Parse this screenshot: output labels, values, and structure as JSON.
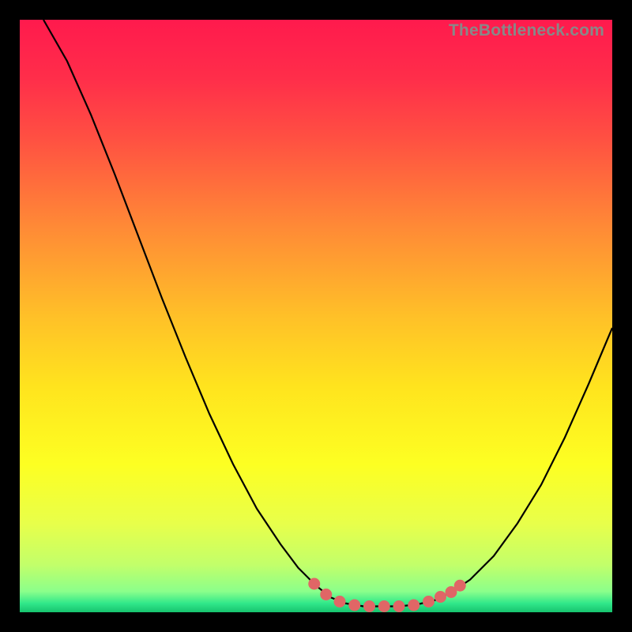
{
  "watermark": "TheBottleneck.com",
  "gradient": {
    "stops": [
      {
        "offset": 0.0,
        "color": "#ff1a4d"
      },
      {
        "offset": 0.1,
        "color": "#ff2e4a"
      },
      {
        "offset": 0.2,
        "color": "#ff5042"
      },
      {
        "offset": 0.35,
        "color": "#ff8a36"
      },
      {
        "offset": 0.5,
        "color": "#ffc028"
      },
      {
        "offset": 0.62,
        "color": "#ffe41e"
      },
      {
        "offset": 0.75,
        "color": "#fdff22"
      },
      {
        "offset": 0.85,
        "color": "#e8ff4a"
      },
      {
        "offset": 0.92,
        "color": "#c2ff6a"
      },
      {
        "offset": 0.965,
        "color": "#8bff8b"
      },
      {
        "offset": 0.985,
        "color": "#30e88a"
      },
      {
        "offset": 1.0,
        "color": "#17c36e"
      }
    ]
  },
  "chart_data": {
    "type": "line",
    "title": "",
    "xlabel": "",
    "ylabel": "",
    "xlim": [
      0,
      100
    ],
    "ylim": [
      0,
      100
    ],
    "series": [
      {
        "name": "curve",
        "points": [
          {
            "x": 4.0,
            "y": 100.0
          },
          {
            "x": 8.0,
            "y": 93.0
          },
          {
            "x": 12.0,
            "y": 84.0
          },
          {
            "x": 16.0,
            "y": 74.0
          },
          {
            "x": 20.0,
            "y": 63.5
          },
          {
            "x": 24.0,
            "y": 53.0
          },
          {
            "x": 28.0,
            "y": 43.0
          },
          {
            "x": 32.0,
            "y": 33.5
          },
          {
            "x": 36.0,
            "y": 25.0
          },
          {
            "x": 40.0,
            "y": 17.5
          },
          {
            "x": 44.0,
            "y": 11.5
          },
          {
            "x": 47.0,
            "y": 7.5
          },
          {
            "x": 50.0,
            "y": 4.5
          },
          {
            "x": 52.5,
            "y": 2.5
          },
          {
            "x": 55.0,
            "y": 1.5
          },
          {
            "x": 58.0,
            "y": 1.0
          },
          {
            "x": 61.0,
            "y": 1.0
          },
          {
            "x": 64.0,
            "y": 1.0
          },
          {
            "x": 67.0,
            "y": 1.3
          },
          {
            "x": 70.0,
            "y": 2.0
          },
          {
            "x": 73.0,
            "y": 3.5
          },
          {
            "x": 76.0,
            "y": 5.5
          },
          {
            "x": 80.0,
            "y": 9.5
          },
          {
            "x": 84.0,
            "y": 15.0
          },
          {
            "x": 88.0,
            "y": 21.5
          },
          {
            "x": 92.0,
            "y": 29.5
          },
          {
            "x": 96.0,
            "y": 38.5
          },
          {
            "x": 100.0,
            "y": 48.0
          }
        ]
      }
    ],
    "highlight_dots": [
      {
        "x": 49.7,
        "y": 4.8
      },
      {
        "x": 51.7,
        "y": 3.0
      },
      {
        "x": 54.0,
        "y": 1.8
      },
      {
        "x": 56.5,
        "y": 1.2
      },
      {
        "x": 59.0,
        "y": 1.0
      },
      {
        "x": 61.5,
        "y": 1.0
      },
      {
        "x": 64.0,
        "y": 1.0
      },
      {
        "x": 66.5,
        "y": 1.2
      },
      {
        "x": 69.0,
        "y": 1.8
      },
      {
        "x": 71.0,
        "y": 2.6
      },
      {
        "x": 72.8,
        "y": 3.4
      },
      {
        "x": 74.3,
        "y": 4.5
      }
    ],
    "highlight_color": "#e06666",
    "curve_color": "#000000"
  }
}
